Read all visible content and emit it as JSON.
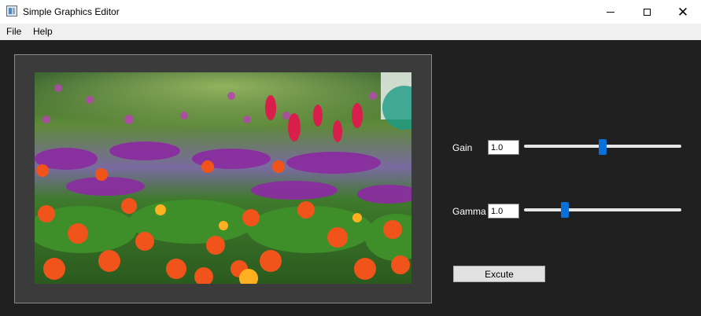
{
  "window": {
    "title": "Simple Graphics Editor",
    "icons": {
      "app": "app-icon",
      "minimize": "minimize-icon",
      "maximize": "maximize-icon",
      "close": "close-icon"
    }
  },
  "menu": {
    "file": "File",
    "help": "Help"
  },
  "controls": {
    "gain": {
      "label": "Gain",
      "value": "1.0",
      "slider_fraction": 0.5
    },
    "gamma": {
      "label": "Gamma",
      "value": "1.0",
      "slider_fraction": 0.25
    },
    "execute_label": "Excute"
  },
  "colors": {
    "background": "#202020",
    "accent": "#0a6fd6",
    "frame": "#3b3b3b"
  }
}
